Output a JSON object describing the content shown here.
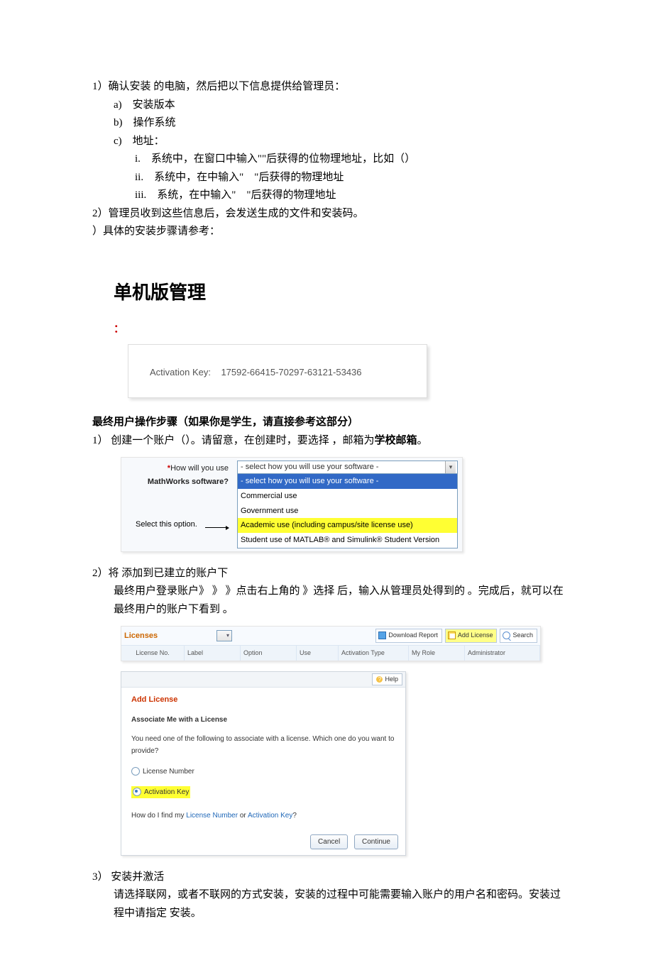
{
  "steps": {
    "s1": "1）确认安装 的电脑，然后把以下信息提供给管理员：",
    "a": "a)　安装版本",
    "b": "b)　操作系统",
    "c": "c)　地址：",
    "i": "i.　系统中，在窗口中输入\"\"后获得的位物理地址，比如（）",
    "ii": "ii.　系统中，在中输入\"　\"后获得的物理地址",
    "iii": "iii.　系统，在中输入\"　\"后获得的物理地址",
    "s2": "2）管理员收到这些信息后，会发送生成的文件和安装码。",
    "s3": "）具体的安装步骤请参考："
  },
  "h2": "单机版管理",
  "colon": "：",
  "ak_label": "Activation Key:",
  "ak_value": "17592-66415-70297-63121-53436",
  "red_line": "最终用户操作步骤（如果你是学生，请直接参考这部分）",
  "p1": "1） 创建一个账户（）。请留意，在创建时，要选择 ，邮箱为",
  "p1_bold": "学校邮箱",
  "p1_end": "。",
  "sel": {
    "label1a": "*",
    "label1b": "How will you use",
    "label2": "MathWorks software?",
    "placeholder": "- select how you will use your software -",
    "opt_hi": "- select how you will use your software -",
    "opt1": "Commercial use",
    "opt2": "Government use",
    "opt3": "Academic use (including campus/site license use)",
    "opt4": "Student use of MATLAB® and Simulink® Student Version",
    "tip": "Select this option."
  },
  "p2a": "2）将 添加到已建立的账户下",
  "p2b": "最终用户登录账户》 》 》点击右上角的 》选择 后，输入从管理员处得到的 。完成后，就可以在最终用户的账户下看到 。",
  "lic": {
    "title": "Licenses",
    "btn_dl": "Download Report",
    "btn_add": "Add License",
    "btn_search": "Search",
    "h_no": "License No.",
    "h_lbl": "Label",
    "h_opt": "Option",
    "h_use": "Use",
    "h_at": "Activation Type",
    "h_role": "My Role",
    "h_admin": "Administrator"
  },
  "dlg": {
    "help": "Help",
    "title": "Add License",
    "sub": "Associate Me with a License",
    "txt": "You need one of the following to associate with a license. Which one do you want to provide?",
    "r1": "License Number",
    "r2": "Activation Key",
    "find1": "How do I find my ",
    "find_l1": "License Number",
    "find_or": " or ",
    "find_l2": "Activation Key",
    "find_q": "?",
    "cancel": "Cancel",
    "cont": "Continue"
  },
  "p3a": "3） 安装并激活",
  "p3b": "请选择联网，或者不联网的方式安装，安装的过程中可能需要输入账户的用户名和密码。安装过程中请指定 安装。"
}
